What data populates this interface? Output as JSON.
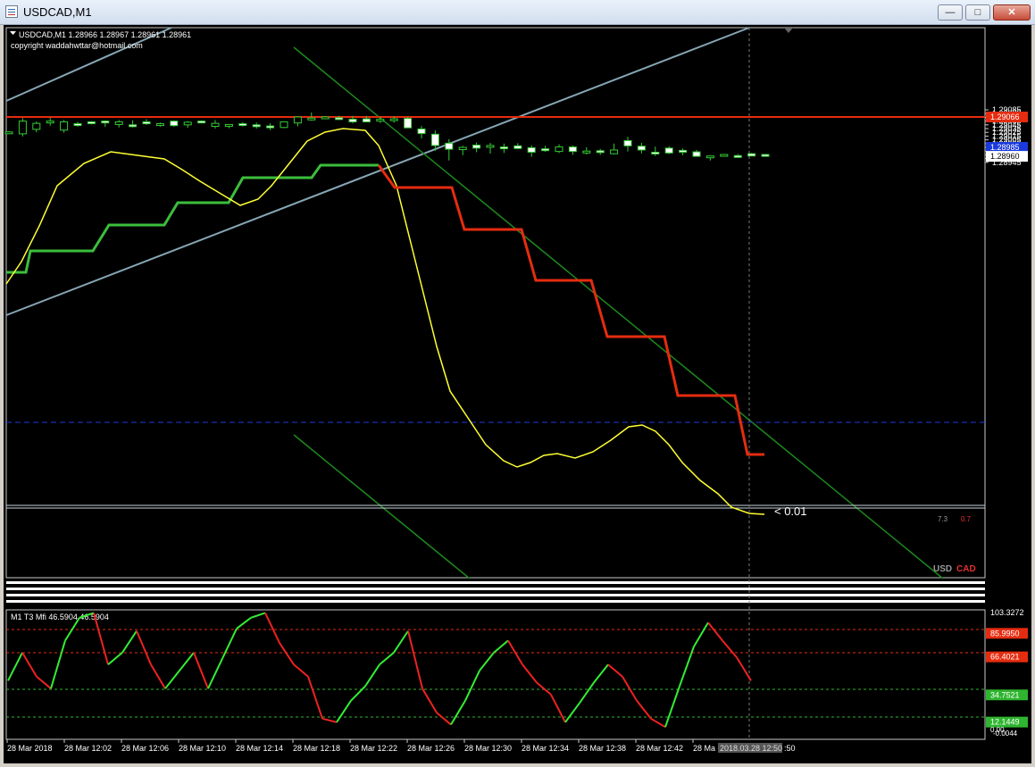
{
  "window": {
    "title": "USDCAD,M1",
    "min_glyph": "—",
    "max_glyph": "□",
    "close_glyph": "✕"
  },
  "chart_info": {
    "symbol_line": "USDCAD,M1  1.28966 1.28967 1.28961 1.28961",
    "copyright": "copyright waddahwttar@hotmail.com"
  },
  "price_axis": {
    "labels": [
      "1.29085",
      "1.29075",
      "1.29065",
      "1.29055",
      "1.29045",
      "1.29035",
      "1.29025",
      "1.29015",
      "1.29005",
      "1.28995",
      "1.28985",
      "1.28975",
      "1.28965",
      "1.28955",
      "1.28945"
    ],
    "red_level_label": "1.29066",
    "blue_level_label": "1.28985",
    "current_label": "1.28960"
  },
  "annotations": {
    "diff": "< 0.01",
    "small_a": "7.3",
    "small_b": "0.7",
    "usd": "USD",
    "cad": "CAD"
  },
  "indicator": {
    "header": "M1  T3 Mfi  46.5904 46.5904",
    "axis_labels": {
      "top": "103.3272",
      "lvl1": "85.9950",
      "lvl2": "66.4021",
      "lvl3": "34.7521",
      "lvl4": "12.1449",
      "bottom": "0.00",
      "bottom2": "-0.0044"
    }
  },
  "time_axis": {
    "labels": [
      "28 Mar 2018",
      "28 Mar 12:02",
      "28 Mar 12:06",
      "28 Mar 12:10",
      "28 Mar 12:14",
      "28 Mar 12:18",
      "28 Mar 12:22",
      "28 Mar 12:26",
      "28 Mar 12:30",
      "28 Mar 12:34",
      "28 Mar 12:38",
      "28 Mar 12:42",
      "28 Ma",
      "2018.03.28 12:50",
      ":50"
    ]
  },
  "colors": {
    "red_line": "#e52c10",
    "blue_dash": "#1a3adc",
    "green_ma": "#3cbe3c",
    "yellow_ma": "#ffff33",
    "channel": "#1c8a1c",
    "trend_blue": "#86a6b4",
    "mfi_up": "#33ee33",
    "mfi_down": "#ee2222"
  },
  "chart_data": [
    {
      "type": "candlestick",
      "series": [
        {
          "name": "USDCAD,M1",
          "ohlc": [
            [
              1.29023,
              1.29028,
              1.29021,
              1.29026
            ],
            [
              1.29021,
              1.29063,
              1.29014,
              1.29055
            ],
            [
              1.29033,
              1.29054,
              1.29025,
              1.29049
            ],
            [
              1.29054,
              1.29064,
              1.29043,
              1.29055
            ],
            [
              1.29031,
              1.29058,
              1.29024,
              1.29053
            ],
            [
              1.29048,
              1.29053,
              1.2904,
              1.29046
            ],
            [
              1.29053,
              1.29055,
              1.29046,
              1.2905
            ],
            [
              1.29055,
              1.29057,
              1.2904,
              1.29053
            ],
            [
              1.29046,
              1.29058,
              1.29038,
              1.29053
            ],
            [
              1.29045,
              1.29057,
              1.29038,
              1.29042
            ],
            [
              1.29053,
              1.2906,
              1.29045,
              1.29048
            ],
            [
              1.29045,
              1.29051,
              1.2904,
              1.29048
            ],
            [
              1.29055,
              1.29057,
              1.2904,
              1.29043
            ],
            [
              1.29045,
              1.29055,
              1.29037,
              1.29052
            ],
            [
              1.29055,
              1.29057,
              1.29049,
              1.29051
            ],
            [
              1.29041,
              1.29058,
              1.29035,
              1.29049
            ],
            [
              1.29042,
              1.29047,
              1.29036,
              1.29046
            ],
            [
              1.29048,
              1.29052,
              1.29041,
              1.29044
            ],
            [
              1.29045,
              1.29051,
              1.29035,
              1.29043
            ],
            [
              1.29042,
              1.29049,
              1.29031,
              1.29038
            ],
            [
              1.29038,
              1.29052,
              1.29036,
              1.29053
            ],
            [
              1.2905,
              1.29062,
              1.29041,
              1.29066
            ],
            [
              1.29061,
              1.29078,
              1.29056,
              1.29063
            ],
            [
              1.29063,
              1.29068,
              1.29062,
              1.29066
            ],
            [
              1.29064,
              1.29069,
              1.29058,
              1.29062
            ],
            [
              1.2906,
              1.29069,
              1.29049,
              1.29053
            ],
            [
              1.29061,
              1.29069,
              1.29052,
              1.29053
            ],
            [
              1.29058,
              1.29067,
              1.2905,
              1.2906
            ],
            [
              1.2906,
              1.29068,
              1.29051,
              1.29061
            ],
            [
              1.29062,
              1.29066,
              1.29047,
              1.29037
            ],
            [
              1.29034,
              1.29042,
              1.29009,
              1.29022
            ],
            [
              1.2902,
              1.2903,
              1.28976,
              1.2899
            ],
            [
              1.28996,
              1.29007,
              1.2895,
              1.2898
            ],
            [
              1.28979,
              1.28989,
              1.28964,
              1.28985
            ],
            [
              1.28991,
              1.28998,
              1.28972,
              1.28983
            ],
            [
              1.28988,
              1.28997,
              1.28968,
              1.2899
            ],
            [
              1.28986,
              1.28995,
              1.2897,
              1.28983
            ],
            [
              1.28989,
              1.28996,
              1.2898,
              1.28982
            ],
            [
              1.28984,
              1.2899,
              1.2896,
              1.28972
            ],
            [
              1.28981,
              1.28989,
              1.28973,
              1.28979
            ],
            [
              1.28974,
              1.28993,
              1.2897,
              1.28986
            ],
            [
              1.28986,
              1.2899,
              1.28965,
              1.28974
            ],
            [
              1.2897,
              1.28985,
              1.28966,
              1.28975
            ],
            [
              1.28976,
              1.28981,
              1.28965,
              1.28974
            ],
            [
              1.28968,
              1.28995,
              1.28966,
              1.28978
            ],
            [
              1.29003,
              1.29013,
              1.28974,
              1.28989
            ],
            [
              1.28988,
              1.28997,
              1.28969,
              1.28978
            ],
            [
              1.28972,
              1.28987,
              1.28962,
              1.28968
            ],
            [
              1.28983,
              1.28988,
              1.28967,
              1.2897
            ],
            [
              1.28977,
              1.28982,
              1.28964,
              1.28972
            ],
            [
              1.28973,
              1.28978,
              1.2896,
              1.28961
            ],
            [
              1.28961,
              1.28963,
              1.2895,
              1.28962
            ],
            [
              1.28962,
              1.28967,
              1.28961,
              1.28966
            ],
            [
              1.28963,
              1.28967,
              1.28957,
              1.28962
            ],
            [
              1.28968,
              1.2897,
              1.28963,
              1.28962
            ],
            [
              1.28966,
              1.28967,
              1.28961,
              1.28961
            ]
          ]
        }
      ]
    },
    {
      "type": "line",
      "title": "M1  T3 Mfi  46.5904 46.5904",
      "series": [
        {
          "name": "T3 Mfi",
          "values": [
            46.6,
            70,
            50,
            40,
            80,
            99,
            103,
            60,
            70,
            88,
            60,
            40,
            55,
            70,
            40,
            65,
            90,
            99,
            103,
            78,
            60,
            50,
            15,
            12,
            30,
            42,
            60,
            70,
            88,
            40,
            20,
            10,
            30,
            55,
            70,
            80,
            60,
            45,
            35,
            12,
            28,
            45,
            60,
            50,
            30,
            15,
            8,
            42,
            75,
            95,
            80,
            66,
            46.6
          ]
        }
      ],
      "ylim": [
        -0.0044,
        103.3272
      ],
      "levels": [
        85.995,
        66.4021,
        34.7521,
        12.1449
      ]
    }
  ]
}
